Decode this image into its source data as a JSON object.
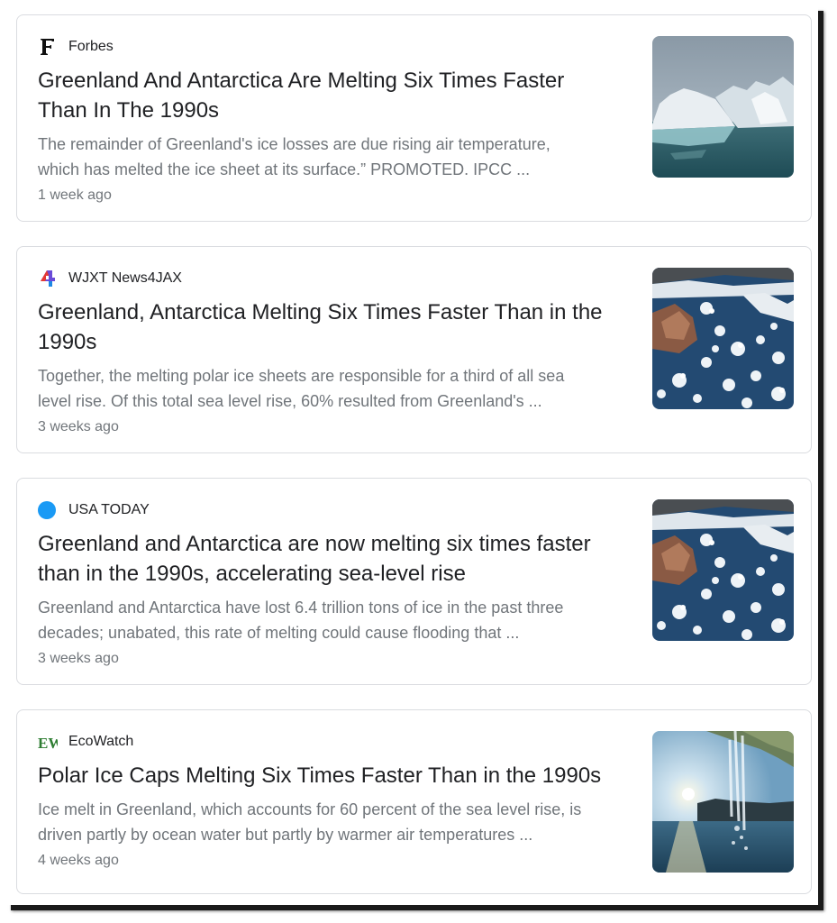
{
  "results": [
    {
      "source": "Forbes",
      "logo_icon": "forbes-f-logo",
      "title_line1": "Greenland And Antarctica Are Melting Six Times Faster",
      "title_line2": "Than In The 1990s",
      "snippet_line1": "The remainder of Greenland's ice losses are due rising air temperature,",
      "snippet_line2": "which has melted the ice sheet at its surface.” PROMOTED. IPCC ...",
      "age": "1 week ago",
      "thumbnail": "iceberg-photo"
    },
    {
      "source": "WJXT News4JAX",
      "logo_icon": "news4jax-logo",
      "title_line1": "Greenland, Antarctica Melting Six Times Faster Than in the",
      "title_line2": "1990s",
      "snippet_line1": "Together, the melting polar ice sheets are responsible for a third of all sea",
      "snippet_line2": "level rise. Of this total sea level rise, 60% resulted from Greenland's ...",
      "age": "3 weeks ago",
      "thumbnail": "aerial-sea-ice-photo"
    },
    {
      "source": "USA TODAY",
      "logo_icon": "usa-today-dot-logo",
      "title_line1": "Greenland and Antarctica are now melting six times faster",
      "title_line2": "than in the 1990s, accelerating sea-level rise",
      "snippet_line1": "Greenland and Antarctica have lost 6.4 trillion tons of ice in the past three",
      "snippet_line2": "decades; unabated, this rate of melting could cause flooding that ...",
      "age": "3 weeks ago",
      "thumbnail": "aerial-sea-ice-photo"
    },
    {
      "source": "EcoWatch",
      "logo_icon": "ecowatch-logo",
      "logo_text": "EW",
      "title_line1": "Polar Ice Caps Melting Six Times Faster Than in the 1990s",
      "title_line2": "",
      "snippet_line1": "Ice melt in Greenland, which accounts for 60 percent of the sea level rise, is",
      "snippet_line2": "driven partly by ocean water but partly by warmer air temperatures ...",
      "age": "4 weeks ago",
      "thumbnail": "meltwater-waterfall-photo"
    }
  ],
  "colors": {
    "title": "#202124",
    "snippet": "#70757a",
    "card_border": "#dadce0",
    "usa_today_dot": "#1a9af5",
    "ecowatch_green": "#2e7d32"
  }
}
